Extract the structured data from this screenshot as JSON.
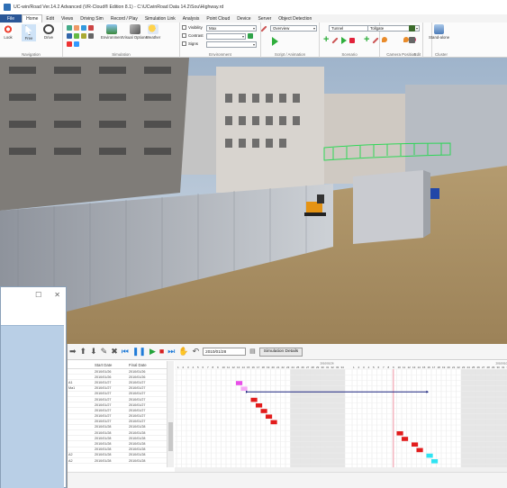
{
  "window": {
    "title": "UC-win/Road Ver.14.2 Advanced (VR-Cloud® Edition 8.1) - C:\\UCwinRoad Data 14.2\\Sou\\Highway.rd"
  },
  "menu": {
    "tabs": [
      "File",
      "Home",
      "Edit",
      "Views",
      "Driving Sim",
      "Record / Play",
      "Simulation Link",
      "Analysis",
      "Point Cloud",
      "Device",
      "Server",
      "Object Detection"
    ],
    "active": "Home"
  },
  "ribbon": {
    "navigation": {
      "label": "Navigation",
      "buttons": [
        "Look",
        "Free",
        "Drive"
      ]
    },
    "simulation": {
      "label": "Simulation",
      "buttons": [
        "Environment",
        "Visual Options",
        "Weather"
      ]
    },
    "environment": {
      "label": "Environment",
      "checks": [
        "Visibility",
        "Contrast",
        "Signs"
      ],
      "visibility_value": "Max"
    },
    "script": {
      "label": "Script / Animation",
      "combo": "Overview"
    },
    "scenario": {
      "label": "Scenario",
      "combo": "Tunnel"
    },
    "camera": {
      "label": "Camera Position",
      "combo": "Tollgate"
    },
    "edit": {
      "label": "Edit"
    },
    "cluster": {
      "label": "Cluster",
      "button": "Stand-alone"
    }
  },
  "scheduler": {
    "date": "2010/01/28",
    "sim_button": "Simulation Details",
    "columns": [
      "",
      "Start Date",
      "Final Date"
    ],
    "rows": [
      {
        "name": "",
        "start": "2010/01/26",
        "end": "2010/01/26"
      },
      {
        "name": "",
        "start": "2010/01/26",
        "end": "2010/01/26"
      },
      {
        "name": "A1",
        "start": "2010/01/27",
        "end": "2010/01/27"
      },
      {
        "name": "Ma1",
        "start": "2010/01/27",
        "end": "2010/01/27"
      },
      {
        "name": "",
        "start": "2010/01/27",
        "end": "2010/01/27"
      },
      {
        "name": "",
        "start": "2010/01/27",
        "end": "2010/01/27"
      },
      {
        "name": "",
        "start": "2010/01/27",
        "end": "2010/01/27"
      },
      {
        "name": "",
        "start": "2010/01/27",
        "end": "2010/01/27"
      },
      {
        "name": "",
        "start": "2010/01/27",
        "end": "2010/01/27"
      },
      {
        "name": "",
        "start": "2010/01/27",
        "end": "2010/01/27"
      },
      {
        "name": "",
        "start": "2010/01/28",
        "end": "2010/01/28"
      },
      {
        "name": "",
        "start": "2010/01/28",
        "end": "2010/01/28"
      },
      {
        "name": "",
        "start": "2010/01/28",
        "end": "2010/01/28"
      },
      {
        "name": "",
        "start": "2010/01/28",
        "end": "2010/01/28"
      },
      {
        "name": "",
        "start": "2010/01/28",
        "end": "2010/01/28"
      },
      {
        "name": "A2",
        "start": "2010/01/28",
        "end": "2010/01/28"
      },
      {
        "name": "A2",
        "start": "2010/01/28",
        "end": "2010/01/28"
      }
    ],
    "month_labels": [
      "2010/01/26",
      "2010/01/28"
    ],
    "day_numbers_1": [
      "1",
      "2",
      "3",
      "4",
      "5",
      "6",
      "7",
      "8",
      "9",
      "10",
      "11",
      "12",
      "13",
      "14",
      "15",
      "16",
      "17",
      "18",
      "19",
      "20",
      "21",
      "22",
      "23",
      "24",
      "25",
      "26",
      "27",
      "28",
      "29",
      "30",
      "31",
      "32",
      "33",
      "34"
    ],
    "day_numbers_2": [
      "1",
      "2",
      "3",
      "4",
      "5",
      "6",
      "7",
      "8",
      "9",
      "10",
      "11",
      "12",
      "13",
      "14",
      "15",
      "16",
      "17",
      "18",
      "19",
      "20",
      "21",
      "22",
      "23",
      "24",
      "25",
      "26",
      "27",
      "28",
      "29",
      "30",
      "31",
      "32",
      "33",
      "34"
    ],
    "colors": {
      "magenta": "#e84fe8",
      "pink": "#f5a8f5",
      "red": "#e21c1c",
      "cyan": "#2fe3f2",
      "navy": "#1a237e",
      "today": "#f5b7c2"
    }
  }
}
